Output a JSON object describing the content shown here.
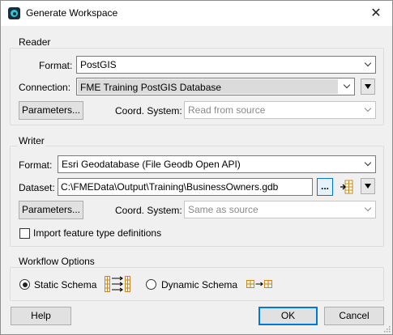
{
  "window": {
    "title": "Generate Workspace",
    "close_glyph": "✕"
  },
  "reader": {
    "group_title": "Reader",
    "format_label": "Format:",
    "format_value": "PostGIS",
    "connection_label": "Connection:",
    "connection_value": "FME Training PostGIS Database",
    "parameters_label": "Parameters...",
    "coord_label": "Coord. System:",
    "coord_value": "Read from source"
  },
  "writer": {
    "group_title": "Writer",
    "format_label": "Format:",
    "format_value": "Esri Geodatabase (File Geodb Open API)",
    "dataset_label": "Dataset:",
    "dataset_value": "C:\\FMEData\\Output\\Training\\BusinessOwners.gdb",
    "browse_label": "...",
    "parameters_label": "Parameters...",
    "coord_label": "Coord. System:",
    "coord_value": "Same as source",
    "import_label": "Import feature type definitions",
    "import_checked": false
  },
  "workflow": {
    "group_title": "Workflow Options",
    "static_label": "Static Schema",
    "static_selected": true,
    "dynamic_label": "Dynamic Schema",
    "dynamic_selected": false
  },
  "footer": {
    "help_label": "Help",
    "ok_label": "OK",
    "cancel_label": "Cancel"
  },
  "icons": {
    "app": "fme-app-icon",
    "close": "close-icon",
    "dropdown": "chevron-down-icon",
    "menu": "triangle-down-icon",
    "dataset_picker": "dataset-picker-icon",
    "static_schema": "static-schema-icon",
    "dynamic_schema": "dynamic-schema-icon"
  },
  "colors": {
    "accent": "#0078d7",
    "window_bg": "#f0f0f0",
    "schema_icon": "#c58a1a"
  }
}
